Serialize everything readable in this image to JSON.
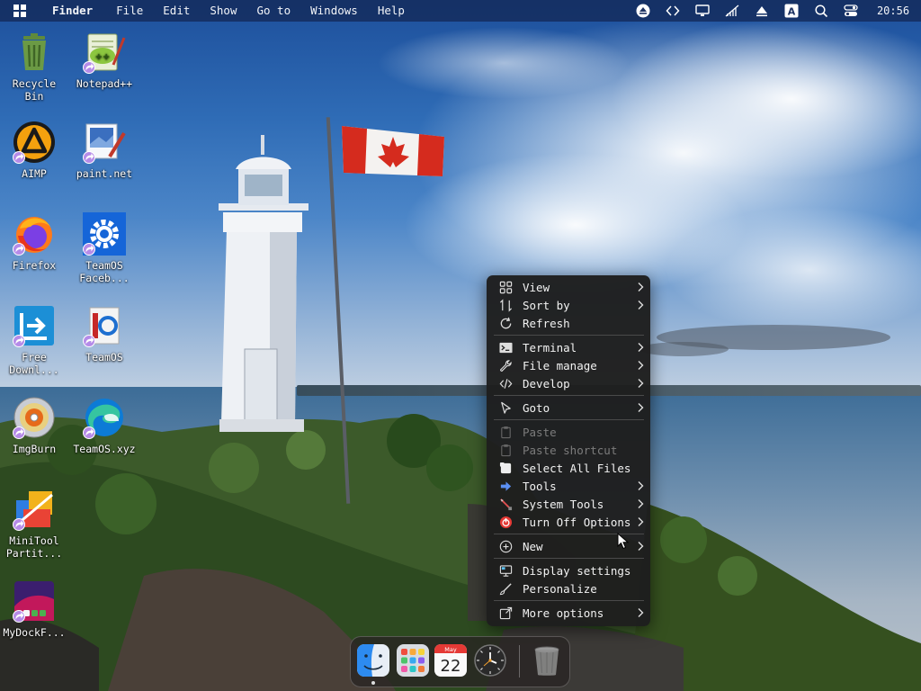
{
  "menubar": {
    "app_name": "Finder",
    "menus": [
      "File",
      "Edit",
      "Show",
      "Go to",
      "Windows",
      "Help"
    ],
    "tray_icons": [
      "eject-icon",
      "code-icon",
      "monitor-icon",
      "network-off-icon",
      "arrow-up-icon",
      "keyboard-layout-icon",
      "search-icon",
      "control-center-icon"
    ],
    "keyboard_indicator": "A",
    "clock": "20:56"
  },
  "desktop": {
    "icons": [
      {
        "label": "Recycle\nBin",
        "icon": "recycle-bin-icon",
        "shortcut": false
      },
      {
        "label": "Notepad++",
        "icon": "notepad-plus-plus-icon",
        "shortcut": true
      },
      {
        "label": "AIMP",
        "icon": "aimp-icon",
        "shortcut": true
      },
      {
        "label": "paint.net",
        "icon": "paint-net-icon",
        "shortcut": true
      },
      {
        "label": "Firefox",
        "icon": "firefox-icon",
        "shortcut": true
      },
      {
        "label": "TeamOS\nFaceb...",
        "icon": "gear-icon",
        "shortcut": true
      },
      {
        "label": "Free\nDownl...",
        "icon": "free-download-manager-icon",
        "shortcut": true
      },
      {
        "label": "TeamOS",
        "icon": "teamos-icon",
        "shortcut": true
      },
      {
        "label": "ImgBurn",
        "icon": "imgburn-disc-icon",
        "shortcut": true
      },
      {
        "label": "TeamOS.xyz",
        "icon": "edge-icon",
        "shortcut": true
      },
      {
        "label": "MiniTool\nPartit...",
        "icon": "minitool-partition-icon",
        "shortcut": true
      },
      {
        "label": "MyDockF...",
        "icon": "mydockfinder-icon",
        "shortcut": true
      }
    ]
  },
  "context_menu": {
    "groups": [
      [
        {
          "label": "View",
          "icon": "grid-icon",
          "submenu": true,
          "disabled": false
        },
        {
          "label": "Sort by",
          "icon": "sort-icon",
          "submenu": true,
          "disabled": false
        },
        {
          "label": "Refresh",
          "icon": "refresh-icon",
          "submenu": false,
          "disabled": false
        }
      ],
      [
        {
          "label": "Terminal",
          "icon": "terminal-icon",
          "submenu": true,
          "disabled": false
        },
        {
          "label": "File manage",
          "icon": "wrench-icon",
          "submenu": true,
          "disabled": false
        },
        {
          "label": "Develop",
          "icon": "code-icon",
          "submenu": true,
          "disabled": false
        }
      ],
      [
        {
          "label": "Goto",
          "icon": "pointer-icon",
          "submenu": true,
          "disabled": false
        }
      ],
      [
        {
          "label": "Paste",
          "icon": "clipboard-icon",
          "submenu": false,
          "disabled": true
        },
        {
          "label": "Paste shortcut",
          "icon": "clipboard-icon",
          "submenu": false,
          "disabled": true
        },
        {
          "label": "Select All Files",
          "icon": "select-all-icon",
          "submenu": false,
          "disabled": false
        },
        {
          "label": "Tools",
          "icon": "arrow-right-icon",
          "submenu": true,
          "disabled": false
        },
        {
          "label": "System Tools",
          "icon": "pen-tool-icon",
          "submenu": true,
          "disabled": false
        },
        {
          "label": "Turn Off Options",
          "icon": "power-icon",
          "submenu": true,
          "disabled": false
        }
      ],
      [
        {
          "label": "New",
          "icon": "plus-circle-icon",
          "submenu": true,
          "disabled": false
        }
      ],
      [
        {
          "label": "Display settings",
          "icon": "display-icon",
          "submenu": false,
          "disabled": false
        },
        {
          "label": "Personalize",
          "icon": "brush-icon",
          "submenu": false,
          "disabled": false
        }
      ],
      [
        {
          "label": "More options",
          "icon": "external-link-icon",
          "submenu": true,
          "disabled": false
        }
      ]
    ]
  },
  "dock": {
    "items": [
      {
        "name": "Finder",
        "icon": "finder-icon",
        "running": true
      },
      {
        "name": "Launchpad",
        "icon": "launchpad-icon",
        "running": false
      },
      {
        "name": "Calendar",
        "icon": "calendar-icon",
        "running": false,
        "month": "May",
        "day": "22"
      },
      {
        "name": "Clock",
        "icon": "clock-icon",
        "running": false
      },
      {
        "name": "Trash",
        "icon": "trash-icon",
        "running": false
      }
    ]
  },
  "colors": {
    "menu_bg": "#1e1e1e",
    "menu_text": "#f2f2f2",
    "menu_disabled": "#7c7c7c",
    "menubar_bg": "#122652",
    "flag_red": "#d52b1e"
  }
}
